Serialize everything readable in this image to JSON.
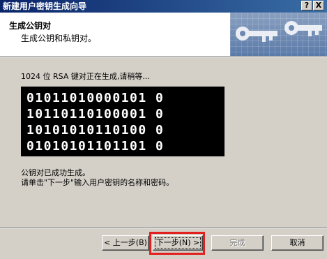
{
  "window": {
    "title": "新建用户密钥生成向导",
    "help_glyph": "?",
    "close_glyph": "X"
  },
  "header": {
    "title": "生成公钥对",
    "subtitle": "生成公钥和私钥对。"
  },
  "main": {
    "status": "1024 位 RSA 键对正在生成,请稍等...",
    "binary_lines": [
      "01011010000101 0",
      "10110110100001 0",
      "10101010110100 0",
      "01010101101101 0"
    ],
    "done_line1": "公钥对已成功生成。",
    "done_line2": "请单击\"下一步\"输入用户密钥的名称和密码。"
  },
  "buttons": {
    "back": "< 上一步(B)",
    "next": "下一步(N) >",
    "finish": "完成",
    "cancel": "取消"
  },
  "colors": {
    "titlebar_start": "#0a246a",
    "titlebar_end": "#3a6ea5",
    "highlight": "#e32020"
  }
}
